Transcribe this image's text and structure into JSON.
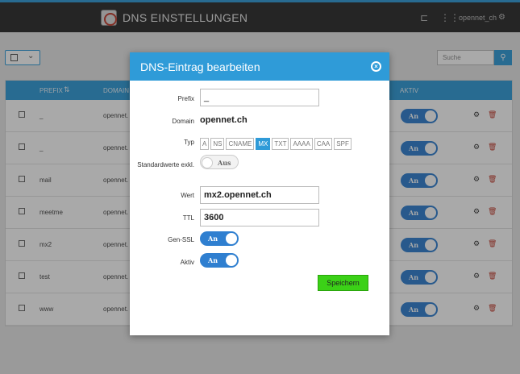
{
  "header": {
    "title": "DNS EINSTELLUNGEN",
    "user": "opennet_ch",
    "icons": [
      "logo-icon",
      "tree-icon",
      "apps-icon",
      "users-gear-icon"
    ]
  },
  "toolbar": {
    "search_placeholder": "Suche",
    "search_icon": "search-icon"
  },
  "table": {
    "columns": [
      "PREFIX",
      "DOMAIN",
      "AKTIV"
    ],
    "toggle_on_label": "An",
    "rows": [
      {
        "prefix": "_",
        "domain": "opennet."
      },
      {
        "prefix": "_",
        "domain": "opennet."
      },
      {
        "prefix": "mail",
        "domain": "opennet."
      },
      {
        "prefix": "meetme",
        "domain": "opennet."
      },
      {
        "prefix": "mx2",
        "domain": "opennet."
      },
      {
        "prefix": "test",
        "domain": "opennet."
      },
      {
        "prefix": "www",
        "domain": "opennet."
      }
    ]
  },
  "modal": {
    "title": "DNS-Eintrag bearbeiten",
    "labels": {
      "prefix": "Prefix",
      "domain": "Domain",
      "typ": "Typ",
      "standardwerte": "Standardwerte exkl.",
      "wert": "Wert",
      "ttl": "TTL",
      "gen_ssl": "Gen-SSL",
      "aktiv": "Aktiv"
    },
    "values": {
      "prefix": "_",
      "domain": "opennet.ch",
      "wert": "mx2.opennet.ch",
      "ttl": "3600"
    },
    "types": [
      "A",
      "NS",
      "CNAME",
      "MX",
      "TXT",
      "AAAA",
      "CAA",
      "SPF"
    ],
    "selected_type": "MX",
    "toggles": {
      "standardwerte": "Aus",
      "gen_ssl": "An",
      "aktiv": "An"
    },
    "save_label": "Speichern"
  },
  "colors": {
    "accent": "#2f9bd8",
    "header_bg": "#2b2b2b",
    "save_green": "#3bd117",
    "toggle_on": "#2f7fd0"
  }
}
